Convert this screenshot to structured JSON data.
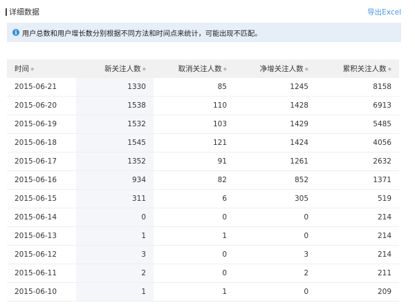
{
  "header": {
    "title": "详细数据",
    "export_label": "导出Excel"
  },
  "notice": {
    "icon": "info-icon",
    "text": "用户总数和用户增长数分别根据不同方法和时间点来统计，可能出现不匹配。"
  },
  "table": {
    "columns": [
      "时间",
      "新关注人数",
      "取消关注人数",
      "净增关注人数",
      "累积关注人数"
    ],
    "rows": [
      [
        "2015-06-21",
        "1330",
        "85",
        "1245",
        "8158"
      ],
      [
        "2015-06-20",
        "1538",
        "110",
        "1428",
        "6913"
      ],
      [
        "2015-06-19",
        "1532",
        "103",
        "1429",
        "5485"
      ],
      [
        "2015-06-18",
        "1545",
        "121",
        "1424",
        "4056"
      ],
      [
        "2015-06-17",
        "1352",
        "91",
        "1261",
        "2632"
      ],
      [
        "2015-06-16",
        "934",
        "82",
        "852",
        "1371"
      ],
      [
        "2015-06-15",
        "311",
        "6",
        "305",
        "519"
      ],
      [
        "2015-06-14",
        "0",
        "0",
        "0",
        "214"
      ],
      [
        "2015-06-13",
        "1",
        "1",
        "0",
        "214"
      ],
      [
        "2015-06-12",
        "3",
        "0",
        "3",
        "214"
      ],
      [
        "2015-06-11",
        "2",
        "0",
        "2",
        "211"
      ],
      [
        "2015-06-10",
        "1",
        "1",
        "0",
        "209"
      ]
    ]
  },
  "colors": {
    "accent_link": "#459ae9",
    "notice_bg": "#e6eef8",
    "info_icon": "#2f8fe0",
    "header_bg": "#f1f1f1",
    "highlight_col_bg": "#f4f6fa"
  }
}
